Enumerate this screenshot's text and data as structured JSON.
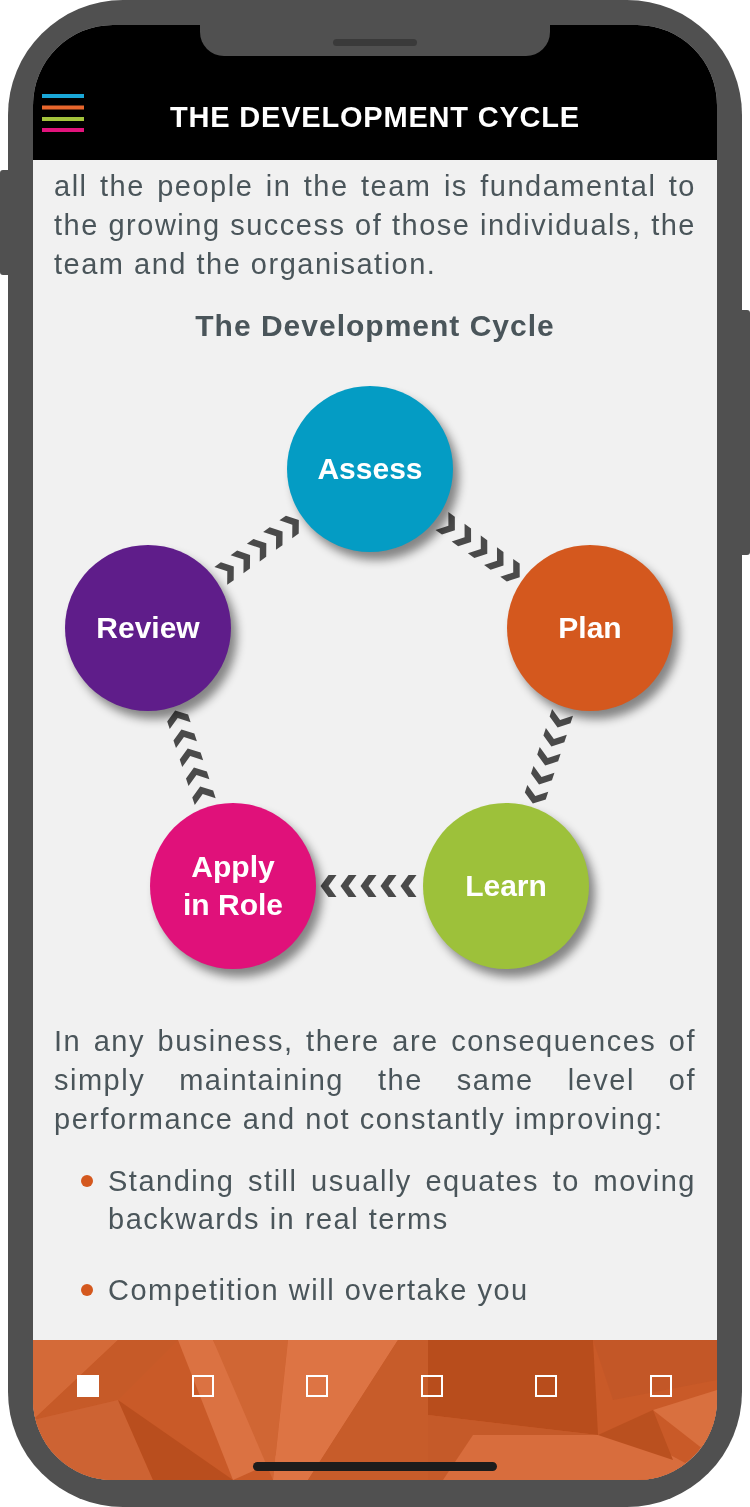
{
  "header": {
    "title": "THE DEVELOPMENT CYCLE"
  },
  "intro": "all the people in the team is fundamental to the growing success of those individuals, the team and the organisation.",
  "diagram": {
    "title": "The Development Cycle",
    "steps": [
      {
        "label": "Assess",
        "color": "#049cc4"
      },
      {
        "label": "Plan",
        "color": "#d4581e"
      },
      {
        "label": "Learn",
        "color": "#9dc13a"
      },
      {
        "label": "Apply in Role",
        "color": "#e0117a"
      },
      {
        "label": "Review",
        "color": "#5f1d8a"
      }
    ]
  },
  "body": "In any business, there are consequences of simply maintaining the same level of performance and not constantly improving:",
  "bullets": [
    "Standing still usually equates to moving backwards in real terms",
    "Competition will overtake you"
  ],
  "pager": [
    {
      "selected": true
    },
    {
      "selected": false
    },
    {
      "selected": false
    },
    {
      "selected": false
    },
    {
      "selected": false
    },
    {
      "selected": false
    }
  ]
}
